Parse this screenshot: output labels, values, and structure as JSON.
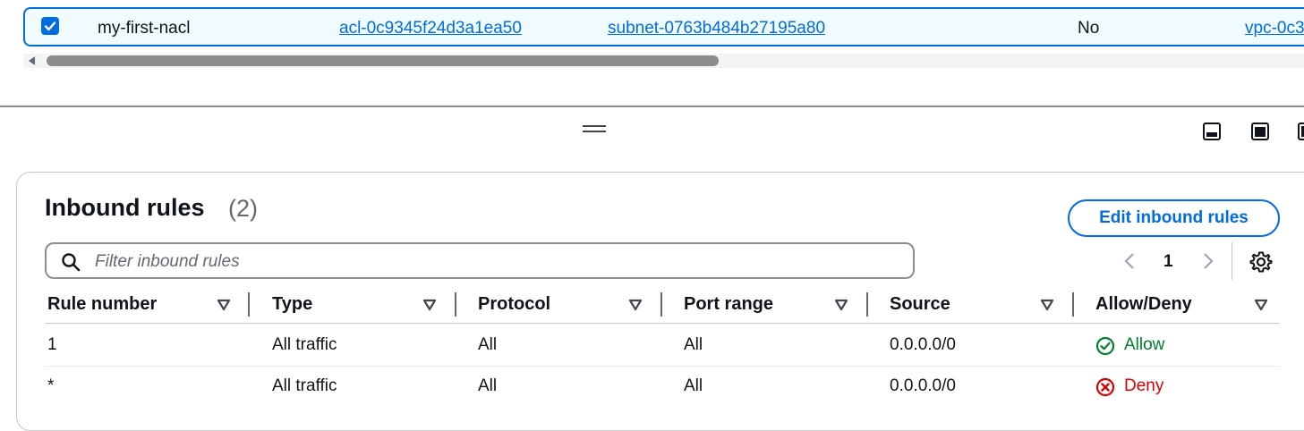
{
  "selected_row": {
    "name": "my-first-nacl",
    "acl_id": "acl-0c9345f24d3a1ea50",
    "subnet_id": "subnet-0763b484b27195a80",
    "default": "No",
    "vpc_id": "vpc-0c3"
  },
  "section": {
    "title": "Inbound rules",
    "count": "(2)",
    "edit_button": "Edit inbound rules",
    "filter_placeholder": "Filter inbound rules",
    "page": "1"
  },
  "columns": [
    "Rule number",
    "Type",
    "Protocol",
    "Port range",
    "Source",
    "Allow/Deny"
  ],
  "rows": [
    {
      "rule_number": "1",
      "type": "All traffic",
      "protocol": "All",
      "port_range": "All",
      "source": "0.0.0.0/0",
      "action": "Allow"
    },
    {
      "rule_number": "*",
      "type": "All traffic",
      "protocol": "All",
      "port_range": "All",
      "source": "0.0.0.0/0",
      "action": "Deny"
    }
  ],
  "colors": {
    "accent": "#006ce0",
    "allow": "#00802f",
    "deny": "#db0000"
  },
  "icons": {
    "check": "check-icon",
    "search": "search-icon",
    "settings": "gear-icon",
    "allow": "check-circle-icon",
    "deny": "x-circle-icon"
  }
}
